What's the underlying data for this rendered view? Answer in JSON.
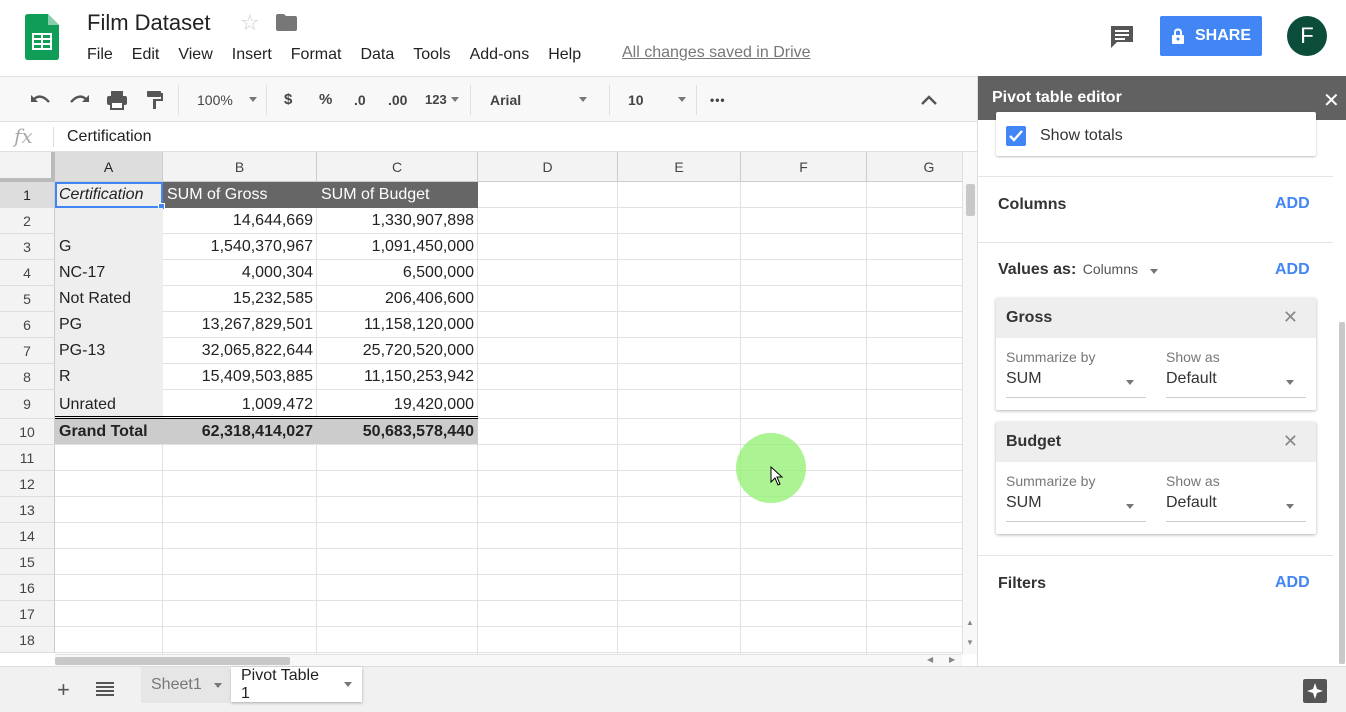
{
  "header": {
    "doc_title": "Film Dataset",
    "menu": [
      "File",
      "Edit",
      "View",
      "Insert",
      "Format",
      "Data",
      "Tools",
      "Add-ons",
      "Help"
    ],
    "saved_status": "All changes saved in Drive",
    "share_label": "SHARE",
    "avatar_letter": "F"
  },
  "toolbar": {
    "zoom": "100%",
    "currency": "$",
    "percent": "%",
    "dec_decrease": ".0",
    "dec_increase": ".00",
    "more_formats": "123",
    "font": "Arial",
    "font_size": "10",
    "more": "•••"
  },
  "formula_bar": {
    "fx": "fx",
    "content": "Certification"
  },
  "grid": {
    "columns": [
      "A",
      "B",
      "C",
      "D",
      "E",
      "F",
      "G"
    ],
    "rows": [
      "1",
      "2",
      "3",
      "4",
      "5",
      "6",
      "7",
      "8",
      "9",
      "10",
      "11",
      "12",
      "13",
      "14",
      "15",
      "16",
      "17",
      "18"
    ],
    "pivot_header": [
      "Certification",
      "SUM of Gross",
      "SUM of Budget"
    ],
    "pivot_rows": [
      [
        "",
        "14,644,669",
        "1,330,907,898"
      ],
      [
        "G",
        "1,540,370,967",
        "1,091,450,000"
      ],
      [
        "NC-17",
        "4,000,304",
        "6,500,000"
      ],
      [
        "Not Rated",
        "15,232,585",
        "206,406,600"
      ],
      [
        "PG",
        "13,267,829,501",
        "11,158,120,000"
      ],
      [
        "PG-13",
        "32,065,822,644",
        "25,720,520,000"
      ],
      [
        "R",
        "15,409,503,885",
        "11,150,253,942"
      ],
      [
        "Unrated",
        "1,009,472",
        "19,420,000"
      ]
    ],
    "grand_total": [
      "Grand Total",
      "62,318,414,027",
      "50,683,578,440"
    ]
  },
  "sheets": {
    "tabs": [
      "Sheet1",
      "Pivot Table 1"
    ],
    "active_index": 1
  },
  "panel": {
    "title": "Pivot table editor",
    "show_totals_label": "Show totals",
    "show_totals_checked": true,
    "columns_label": "Columns",
    "add_label": "ADD",
    "values_as_label": "Values as:",
    "values_as_value": "Columns",
    "values": [
      {
        "name": "Gross",
        "summarize_label": "Summarize by",
        "summarize_value": "SUM",
        "show_as_label": "Show as",
        "show_as_value": "Default"
      },
      {
        "name": "Budget",
        "summarize_label": "Summarize by",
        "summarize_value": "SUM",
        "show_as_label": "Show as",
        "show_as_value": "Default"
      }
    ],
    "filters_label": "Filters"
  },
  "colors": {
    "accent": "#4285f4",
    "pivot_header_bg": "#666666",
    "pivot_label_bg": "#eeeeee",
    "grand_total_bg": "#cccccc",
    "sheets_green": "#0f9d58"
  }
}
